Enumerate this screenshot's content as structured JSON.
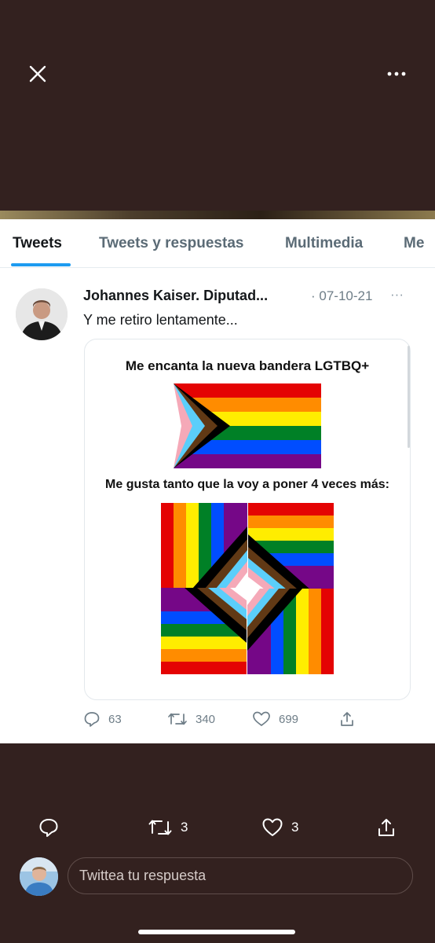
{
  "viewer": {
    "close_icon": "close-icon",
    "more_icon": "more-horizontal-icon"
  },
  "screenshot": {
    "tabs": [
      {
        "label": "Tweets",
        "active": true
      },
      {
        "label": "Tweets y respuestas",
        "active": false
      },
      {
        "label": "Multimedia",
        "active": false
      },
      {
        "label": "Me",
        "active": false
      }
    ],
    "tweet": {
      "author": "Johannes Kaiser. Diputad...",
      "date": "· 07-10-21",
      "more": "···",
      "text": "Y me retiro lentamente...",
      "media": {
        "caption_top": "Me encanta la nueva bandera LGTBQ+",
        "caption_bottom": "Me gusta tanto que la voy a poner 4 veces más:"
      },
      "actions": {
        "replies": "63",
        "retweets": "340",
        "likes": "699"
      }
    }
  },
  "bottom_bar": {
    "retweet_count": "3",
    "like_count": "3",
    "reply_placeholder": "Twittea tu respuesta"
  },
  "colors": {
    "background": "#33211f",
    "accent": "#1d9bf0",
    "rainbow": [
      "#e40303",
      "#ff8c00",
      "#ffed00",
      "#008026",
      "#004dff",
      "#750787"
    ],
    "progress_chevrons": [
      "#ffffff",
      "#f5a9b8",
      "#5bcefa",
      "#613915",
      "#000000"
    ]
  }
}
